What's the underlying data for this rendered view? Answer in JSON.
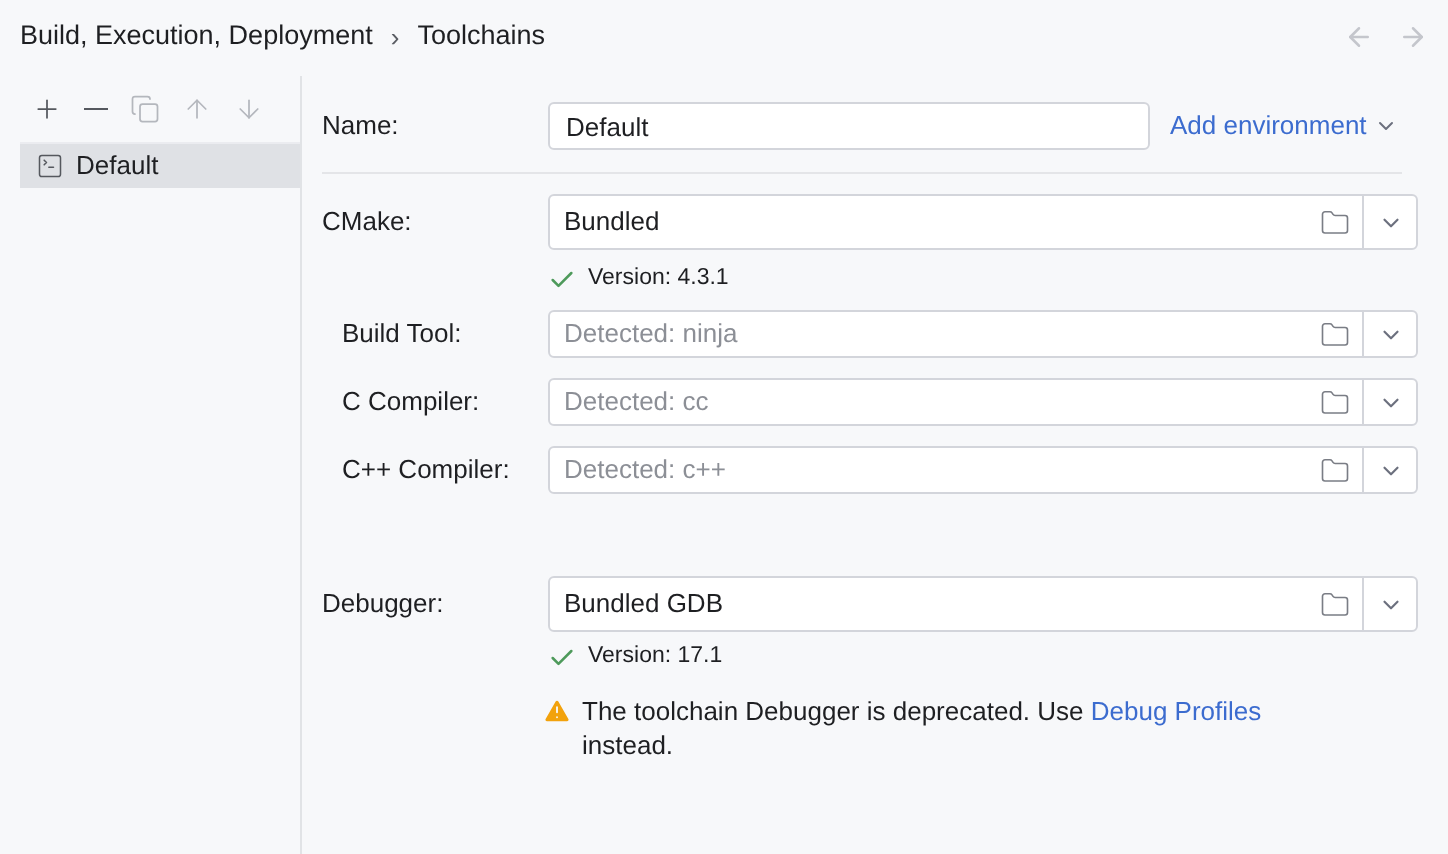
{
  "breadcrumb": {
    "parent": "Build, Execution, Deployment",
    "separator": "›",
    "current": "Toolchains"
  },
  "toolbar": [
    {
      "kind": "add",
      "disabled": false
    },
    {
      "kind": "remove",
      "disabled": false
    },
    {
      "kind": "copy",
      "disabled": true
    },
    {
      "kind": "up",
      "disabled": true
    },
    {
      "kind": "down",
      "disabled": true
    }
  ],
  "toolchains": [
    {
      "label": "Default",
      "selected": true
    }
  ],
  "name_field": {
    "label": "Name:",
    "value": "Default"
  },
  "add_environment": "Add environment",
  "cmake": {
    "label": "CMake:",
    "value": "Bundled",
    "version": "Version: 4.3.1"
  },
  "cmake_tools": [
    {
      "label": "Build Tool:",
      "placeholder": "Detected: ninja"
    },
    {
      "label": "C Compiler:",
      "placeholder": "Detected: cc"
    },
    {
      "label": "C++ Compiler:",
      "placeholder": "Detected: c++"
    }
  ],
  "debugger": {
    "label": "Debugger:",
    "value": "Bundled GDB",
    "version": "Version: 17.1"
  },
  "warning": {
    "before": "The toolchain Debugger is deprecated. Use ",
    "link": "Debug Profiles",
    "after": "instead."
  }
}
